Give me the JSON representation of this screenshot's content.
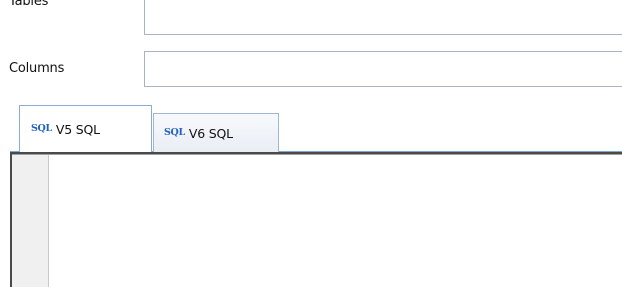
{
  "fields": {
    "tables": {
      "label": "Tables",
      "value": ""
    },
    "columns": {
      "label": "Columns",
      "value": ""
    }
  },
  "tabs": [
    {
      "icon": "SQL",
      "label": "V5 SQL",
      "active": true
    },
    {
      "icon": "SQL",
      "label": "V6 SQL",
      "active": false
    }
  ],
  "editor": {
    "content": ""
  },
  "colors": {
    "tab_icon": "#1e5fbf",
    "tab_border": "#8aaed2",
    "input_border": "#a9b4c0"
  }
}
